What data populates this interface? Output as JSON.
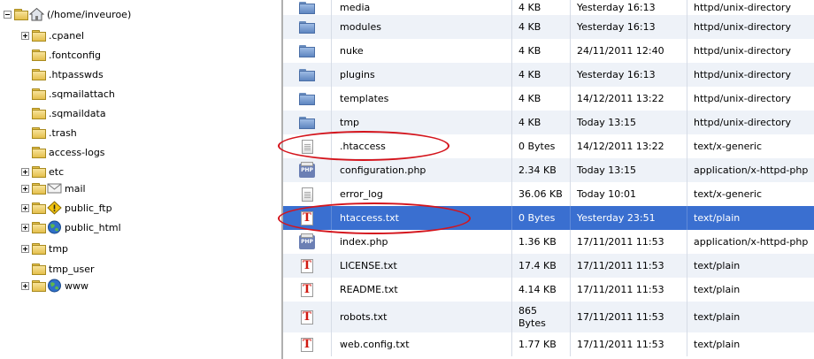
{
  "tree": {
    "root": {
      "label": "(/home/inveuroe)",
      "icon": "home-icon"
    },
    "items": [
      {
        "label": ".cpanel",
        "expandable": true,
        "overlay": ""
      },
      {
        "label": ".fontconfig",
        "expandable": false,
        "overlay": ""
      },
      {
        "label": ".htpasswds",
        "expandable": false,
        "overlay": ""
      },
      {
        "label": ".sqmailattach",
        "expandable": false,
        "overlay": ""
      },
      {
        "label": ".sqmaildata",
        "expandable": false,
        "overlay": ""
      },
      {
        "label": ".trash",
        "expandable": false,
        "overlay": ""
      },
      {
        "label": "access-logs",
        "expandable": false,
        "overlay": ""
      },
      {
        "label": "etc",
        "expandable": true,
        "overlay": ""
      },
      {
        "label": "mail",
        "expandable": true,
        "overlay": "mail-envelope-icon"
      },
      {
        "label": "public_ftp",
        "expandable": true,
        "overlay": "ftp-warning-icon"
      },
      {
        "label": "public_html",
        "expandable": true,
        "overlay": "globe-icon"
      },
      {
        "label": "tmp",
        "expandable": true,
        "overlay": ""
      },
      {
        "label": "tmp_user",
        "expandable": false,
        "overlay": ""
      },
      {
        "label": "www",
        "expandable": true,
        "overlay": "globe-icon"
      }
    ]
  },
  "files": [
    {
      "name": "media",
      "size": "4 KB",
      "modified": "Yesterday 16:13",
      "type": "httpd/unix-directory",
      "icon": "folder-icon"
    },
    {
      "name": "modules",
      "size": "4 KB",
      "modified": "Yesterday 16:13",
      "type": "httpd/unix-directory",
      "icon": "folder-icon"
    },
    {
      "name": "nuke",
      "size": "4 KB",
      "modified": "24/11/2011 12:40",
      "type": "httpd/unix-directory",
      "icon": "folder-icon"
    },
    {
      "name": "plugins",
      "size": "4 KB",
      "modified": "Yesterday 16:13",
      "type": "httpd/unix-directory",
      "icon": "folder-icon"
    },
    {
      "name": "templates",
      "size": "4 KB",
      "modified": "14/12/2011 13:22",
      "type": "httpd/unix-directory",
      "icon": "folder-icon"
    },
    {
      "name": "tmp",
      "size": "4 KB",
      "modified": "Today 13:15",
      "type": "httpd/unix-directory",
      "icon": "folder-icon"
    },
    {
      "name": ".htaccess",
      "size": "0 Bytes",
      "modified": "14/12/2011 13:22",
      "type": "text/x-generic",
      "icon": "generic-file-icon"
    },
    {
      "name": "configuration.php",
      "size": "2.34 KB",
      "modified": "Today 13:15",
      "type": "application/x-httpd-php",
      "icon": "php-file-icon"
    },
    {
      "name": "error_log",
      "size": "36.06 KB",
      "modified": "Today 10:01",
      "type": "text/x-generic",
      "icon": "generic-file-icon"
    },
    {
      "name": "htaccess.txt",
      "size": "0 Bytes",
      "modified": "Yesterday 23:51",
      "type": "text/plain",
      "icon": "text-file-icon",
      "selected": true
    },
    {
      "name": "index.php",
      "size": "1.36 KB",
      "modified": "17/11/2011 11:53",
      "type": "application/x-httpd-php",
      "icon": "php-file-icon"
    },
    {
      "name": "LICENSE.txt",
      "size": "17.4 KB",
      "modified": "17/11/2011 11:53",
      "type": "text/plain",
      "icon": "text-file-icon"
    },
    {
      "name": "README.txt",
      "size": "4.14 KB",
      "modified": "17/11/2011 11:53",
      "type": "text/plain",
      "icon": "text-file-icon"
    },
    {
      "name": "robots.txt",
      "size": "865 Bytes",
      "modified": "17/11/2011 11:53",
      "type": "text/plain",
      "icon": "text-file-icon"
    },
    {
      "name": "web.config.txt",
      "size": "1.77 KB",
      "modified": "17/11/2011 11:53",
      "type": "text/plain",
      "icon": "text-file-icon"
    }
  ],
  "icon_labels": {
    "php": "PHP",
    "text": "T"
  },
  "colors": {
    "selection": "#3a6fd0",
    "annotation": "#d4141c",
    "row_alt": "#eef2f8"
  }
}
